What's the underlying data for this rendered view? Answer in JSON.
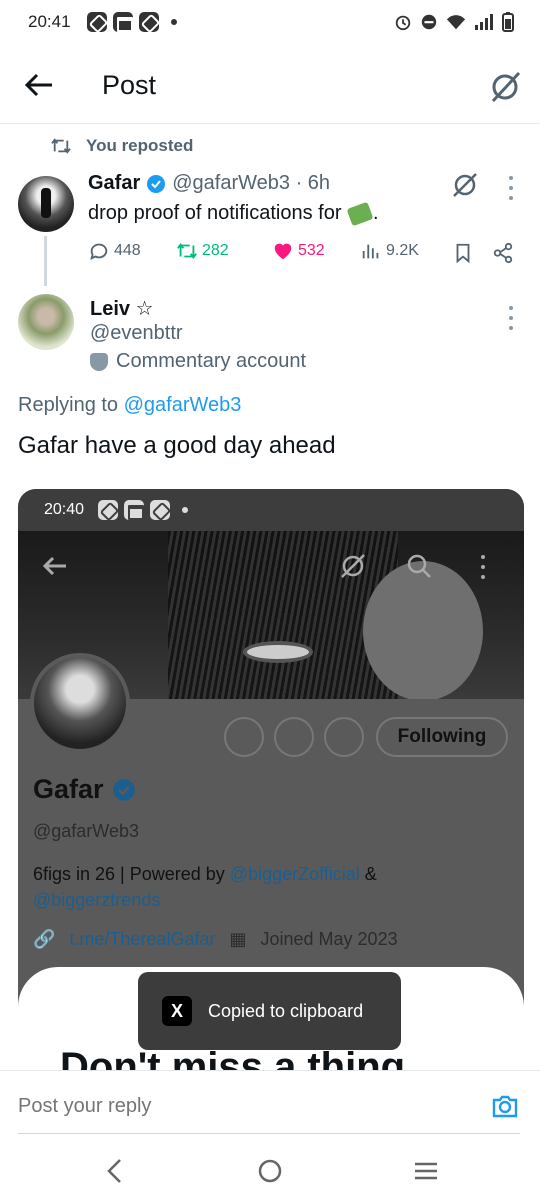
{
  "status_bar": {
    "time": "20:41"
  },
  "header": {
    "title": "Post"
  },
  "repost": {
    "label": "You reposted"
  },
  "tweet": {
    "author_name": "Gafar",
    "handle_time": "@gafarWeb3 · 6h",
    "text": "drop proof of notifications for",
    "text_end": ".",
    "replies": "448",
    "reposts": "282",
    "likes": "532",
    "views": "9.2K"
  },
  "reply": {
    "author_name": "Leiv ☆",
    "author_handle": "@evenbttr",
    "label": "Commentary account",
    "replying_prefix": "Replying to ",
    "replying_handle": "@gafarWeb3",
    "text": "Gafar have a good day ahead"
  },
  "embedded": {
    "time": "20:40",
    "following_label": "Following",
    "name": "Gafar",
    "handle": "@gafarWeb3",
    "bio_prefix": "6figs in 26 | Powered by ",
    "bio_link1": "@biggerZofficial",
    "bio_amp": " &",
    "bio_link2": "@biggerztrends",
    "website": "t.me/TherealGafar",
    "joined": "Joined May 2023",
    "sheet_title": "Don't miss a thing"
  },
  "toast": {
    "logo": "X",
    "text": "Copied to clipboard"
  },
  "reply_bar": {
    "placeholder": "Post your reply"
  },
  "colors": {
    "accent": "#1d9bf0",
    "like": "#f91880",
    "repost": "#00ba7c",
    "secondary": "#536471"
  }
}
